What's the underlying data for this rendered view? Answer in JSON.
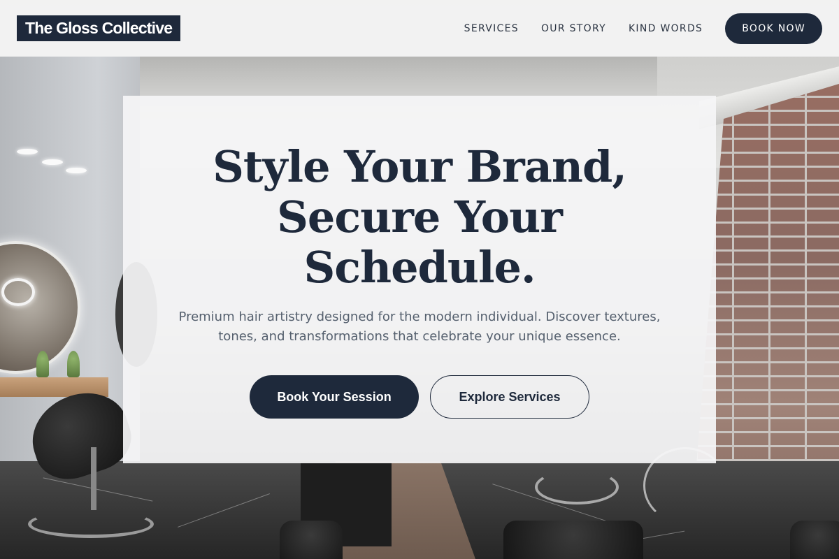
{
  "header": {
    "logo_text": "The Gloss Collective",
    "nav": [
      {
        "label": "SERVICES"
      },
      {
        "label": "OUR STORY"
      },
      {
        "label": "KIND WORDS"
      }
    ],
    "cta_label": "BOOK NOW"
  },
  "hero": {
    "title_lines": [
      "Style Your Brand,",
      "Secure Your",
      "Schedule."
    ],
    "subtitle": "Premium hair artistry designed for the modern individual. Discover textures, tones, and transformations that celebrate your unique essence.",
    "primary_button": "Book Your Session",
    "secondary_button": "Explore Services"
  },
  "background": {
    "image_description_icon": "salon-interior-photo"
  },
  "colors": {
    "brand_navy": "#1e293b",
    "header_bg": "#f3f3f3",
    "card_bg": "#f5f5f6",
    "subtitle_text": "#55606e"
  }
}
